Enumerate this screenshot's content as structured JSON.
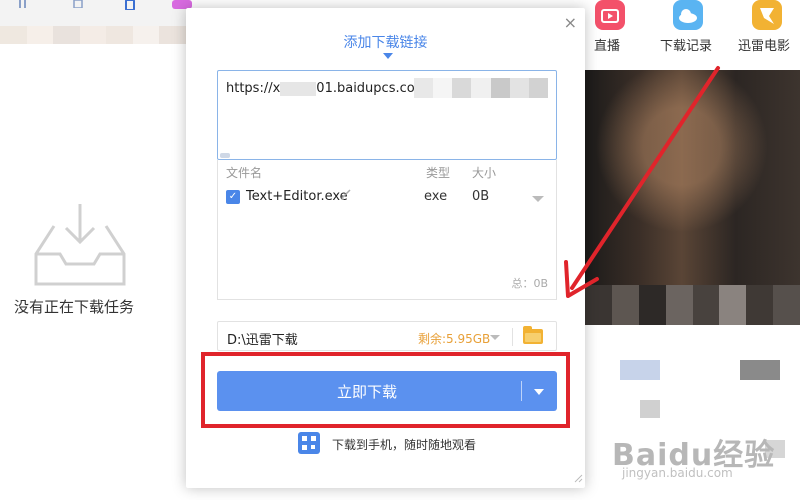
{
  "sidebar": {
    "empty_message": "没有正在下载任务"
  },
  "header_apps": [
    {
      "label": "直播",
      "color": "#f3516a"
    },
    {
      "label": "下载记录",
      "color": "#5ab4f2"
    },
    {
      "label": "迅雷电影",
      "color": "#f2b233"
    }
  ],
  "dialog": {
    "title": "添加下载链接",
    "close_label": "×",
    "url_value": "https://x",
    "url_value_tail": "01.baidupcs.com/file/",
    "columns": {
      "name": "文件名",
      "type": "类型",
      "size": "大小"
    },
    "file": {
      "checkbox": "✓",
      "name": "Text+Editor.exe",
      "type": "exe",
      "size": "0B",
      "checked": true
    },
    "total": "总：0B",
    "save_path": "D:\\迅雷下载",
    "free_space": "剩余:5.95GB",
    "download_button": "立即下载",
    "phone_text": "下载到手机，随时随地观看"
  },
  "watermark": {
    "main": "Baidu经验",
    "sub": "jingyan.baidu.com"
  },
  "colors": {
    "accent": "#4a86e8",
    "button": "#5b91ef",
    "highlight": "#e0242b",
    "free_space": "#e8a038"
  }
}
